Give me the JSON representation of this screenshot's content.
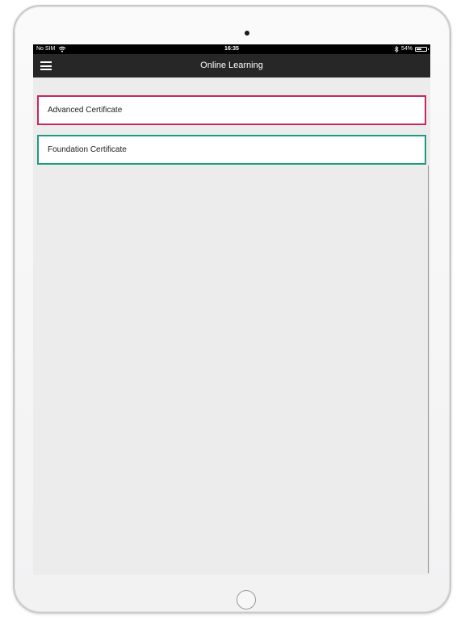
{
  "status_bar": {
    "carrier": "No SIM",
    "time": "16:35",
    "battery_percent": "54%",
    "battery_level": 0.54
  },
  "nav_bar": {
    "title": "Online Learning",
    "menu_icon": "hamburger-menu-icon"
  },
  "courses": [
    {
      "label": "Advanced Certificate",
      "border_color": "#c8265f"
    },
    {
      "label": "Foundation Certificate",
      "border_color": "#1f9a83"
    }
  ],
  "colors": {
    "nav_background": "#272727",
    "screen_background": "#ececec"
  }
}
